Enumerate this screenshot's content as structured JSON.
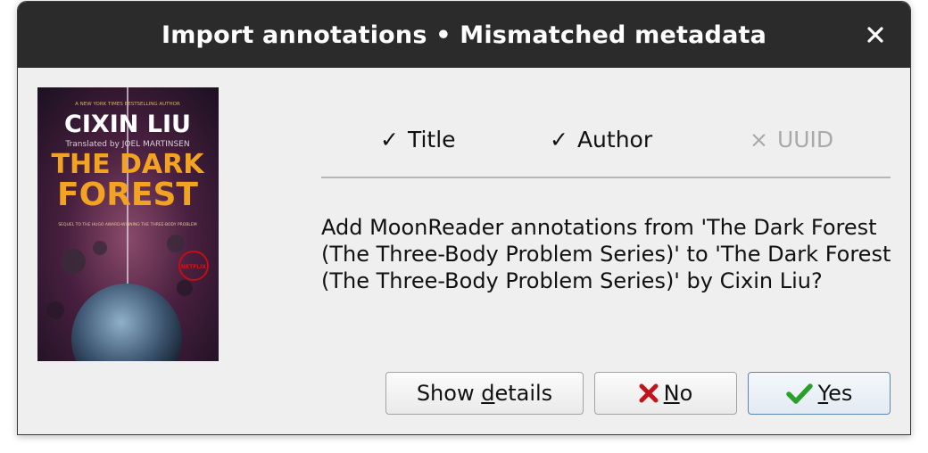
{
  "window": {
    "title": "Import annotations • Mismatched metadata"
  },
  "cover": {
    "tagline": "A NEW YORK TIMES BESTSELLING AUTHOR",
    "author": "CIXIN LIU",
    "translator": "Translated by JOEL MARTINSEN",
    "title_line1": "THE DARK",
    "title_line2": "FOREST",
    "sequel": "SEQUEL TO THE HUGO AWARD-WINNING THE THREE-BODY PROBLEM",
    "badge": "NETFLIX"
  },
  "checks": [
    {
      "label": "Title",
      "mark": "✓",
      "matched": true
    },
    {
      "label": "Author",
      "mark": "✓",
      "matched": true
    },
    {
      "label": "UUID",
      "mark": "×",
      "matched": false
    }
  ],
  "message": "Add MoonReader annotations from 'The Dark Forest (The Three-Body Problem Series)' to 'The Dark Forest (The Three-Body Problem Series)' by Cixin Liu?",
  "buttons": {
    "details_pre": "Show ",
    "details_mnemonic": "d",
    "details_post": "etails",
    "no_mnemonic": "N",
    "no_post": "o",
    "yes_mnemonic": "Y",
    "yes_post": "es"
  },
  "colors": {
    "titlebar": "#2b2b2b",
    "background": "#efefef",
    "no_icon": "#c0161b",
    "yes_icon": "#2aa02a",
    "cover_title": "#f2a322"
  }
}
